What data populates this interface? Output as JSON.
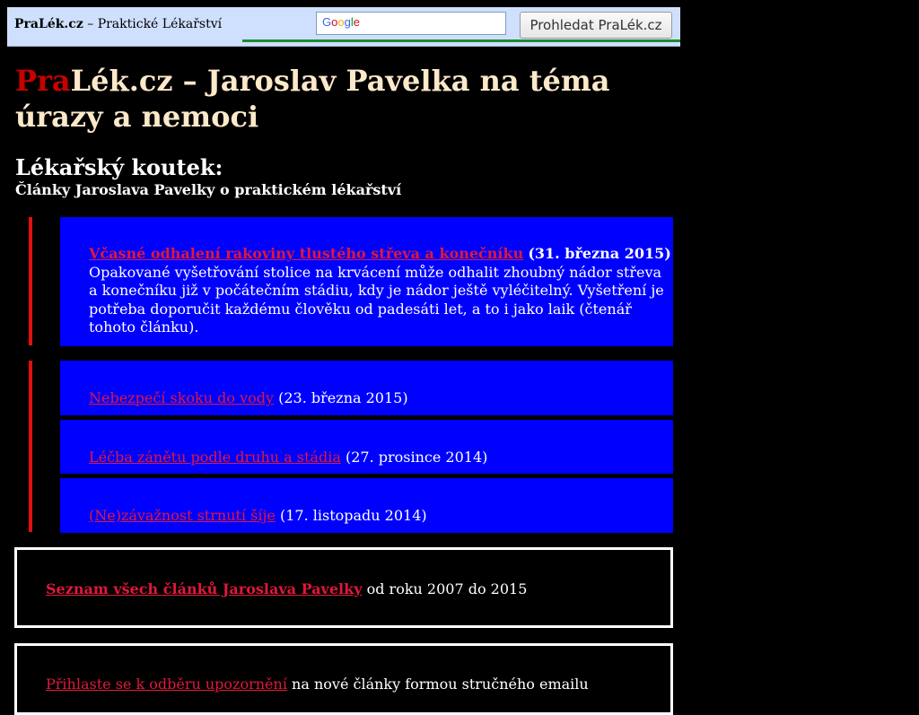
{
  "topbar": {
    "brand": "PraLék.cz",
    "brand_sep": " – ",
    "brand_tagline": "Praktické Lékařství",
    "search_placeholder": "Google",
    "search_button": "Prohledat PraLék.cz"
  },
  "title": {
    "pra": "Pra",
    "rest": "Lék.cz – Jaroslav Pavelka na téma úrazy a nemoci"
  },
  "section": {
    "heading": "Lékařský koutek:",
    "subheading": "Články Jaroslava Pavelky o praktickém lékařství"
  },
  "articles": [
    {
      "link": "Včasné odhalení rakoviny tlustého střeva a konečníku",
      "date": "(31. března 2015)",
      "summary": "Opakované vyšetřování stolice na krvácení může odhalit zhoubný nádor střeva a konečníku již v počátečním stádiu, kdy je nádor ještě vyléčitelný. Vyšetření je potřeba doporučit každému člověku od padesáti let, a to i jako laik (čtenář tohoto článku)."
    },
    {
      "link": "Nebezpečí skoku do vody",
      "date": "(23. března 2015)"
    },
    {
      "link": "Léčba zánětu podle druhu a stádia",
      "date": "(27. prosince 2014)"
    },
    {
      "link": "(Ne)závažnost strnutí šíje",
      "date": "(17. listopadu 2014)"
    }
  ],
  "all_articles": {
    "link": "Seznam všech článků Jaroslava Pavelky",
    "rest": " od roku 2007 do 2015"
  },
  "subscribe": {
    "link": "Přihlaste se k odběru upozornění",
    "rest": " na nové články formou stručného emailu"
  }
}
